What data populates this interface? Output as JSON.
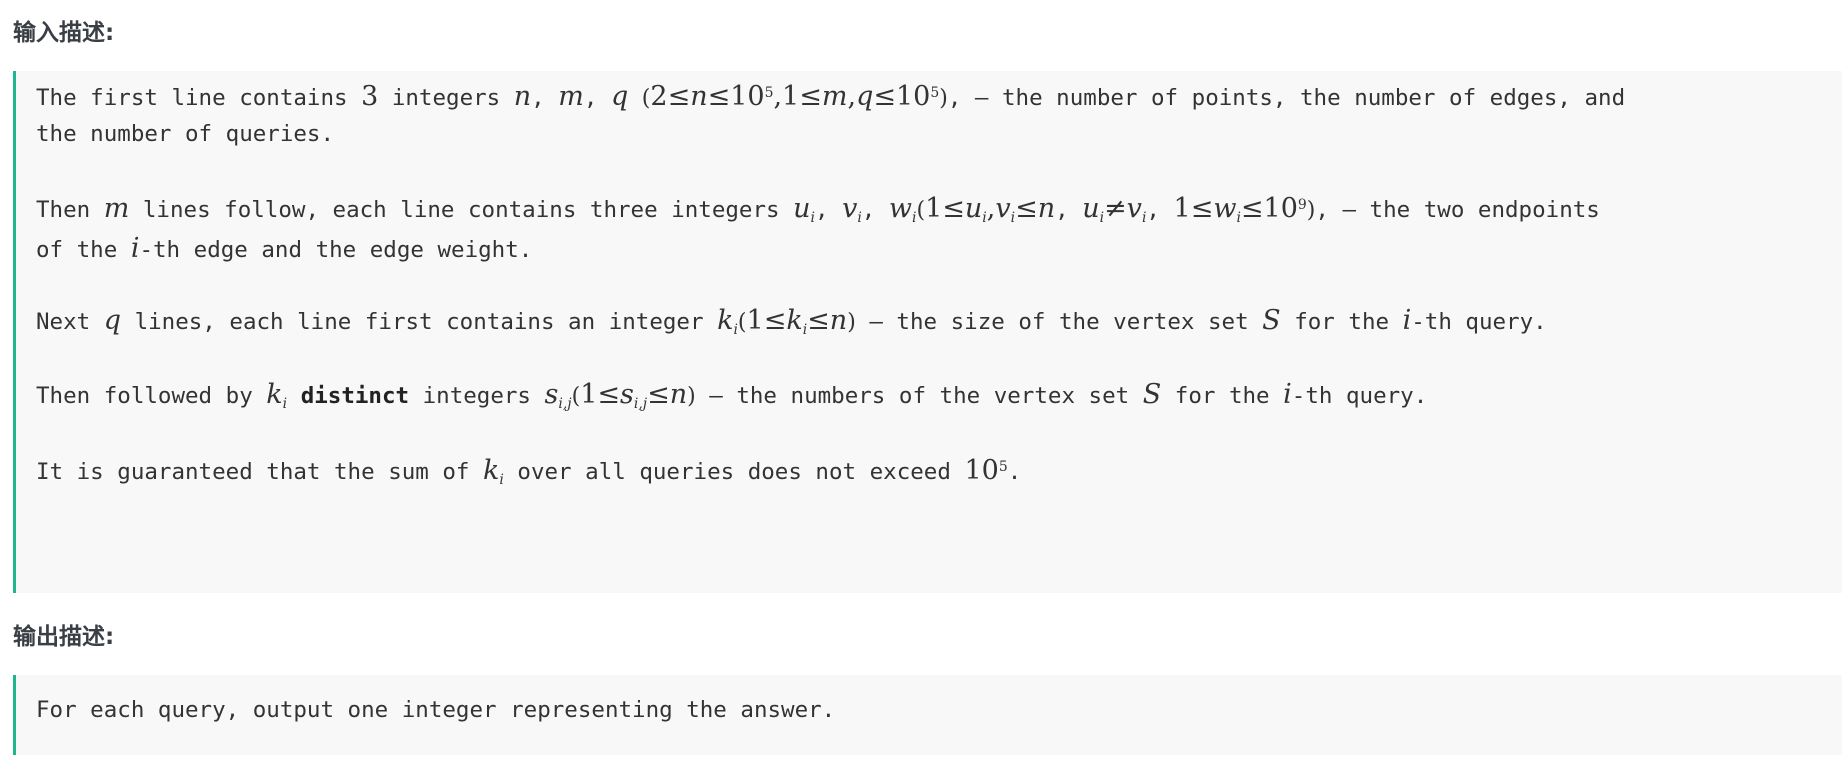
{
  "input_section": {
    "title": "输入描述:",
    "p1": {
      "a": "The first line contains",
      "three": "3",
      "b": "integers",
      "n": "n",
      "comma": ",",
      "m": "m",
      "q": "q",
      "paren_open": "(",
      "two": "2",
      "le": "≤",
      "ten": "10",
      "five": "5",
      "one": "1",
      "paren_close": ")",
      "c": ", – the number of points, the number of edges, and",
      "d": "the number of queries."
    },
    "p2": {
      "a": "Then",
      "m": "m",
      "b": "lines follow, each line contains three integers",
      "u": "u",
      "i": "i",
      "v": "v",
      "w": "w",
      "comma": ",",
      "paren_open": "(",
      "one": "1",
      "le": "≤",
      "n": "n",
      "ne": "≠",
      "ten": "10",
      "nine": "9",
      "paren_close": ")",
      "c": ", – the two endpoints",
      "d": "of the",
      "e": "-th edge and the edge weight."
    },
    "p3": {
      "a": "Next",
      "q": "q",
      "b": "lines, each line first contains an integer",
      "k": "k",
      "i": "i",
      "paren_open": "(",
      "one": "1",
      "le": "≤",
      "n": "n",
      "paren_close": ")",
      "c": "– the size of the vertex set",
      "S": "S",
      "d": "for the",
      "e": "-th query."
    },
    "p4": {
      "a": "Then followed by",
      "k": "k",
      "i": "i",
      "distinct": "distinct",
      "b": "integers",
      "s": "s",
      "ij": "i,j",
      "paren_open": "(",
      "one": "1",
      "le": "≤",
      "n": "n",
      "paren_close": ")",
      "c": "– the numbers of the vertex set",
      "S": "S",
      "d": "for the",
      "e": "-th query."
    },
    "p5": {
      "a": "It is guaranteed that the sum of",
      "k": "k",
      "i": "i",
      "b": "over all queries does not exceed",
      "ten": "10",
      "five": "5",
      "dot": "."
    }
  },
  "output_section": {
    "title": "输出描述:",
    "text": "For each query, output one integer representing the answer."
  },
  "colors": {
    "accent_border": "#1fb58f",
    "box_background": "#f8f8f8",
    "title_color": "#3a3f45",
    "text_color": "#333333"
  }
}
